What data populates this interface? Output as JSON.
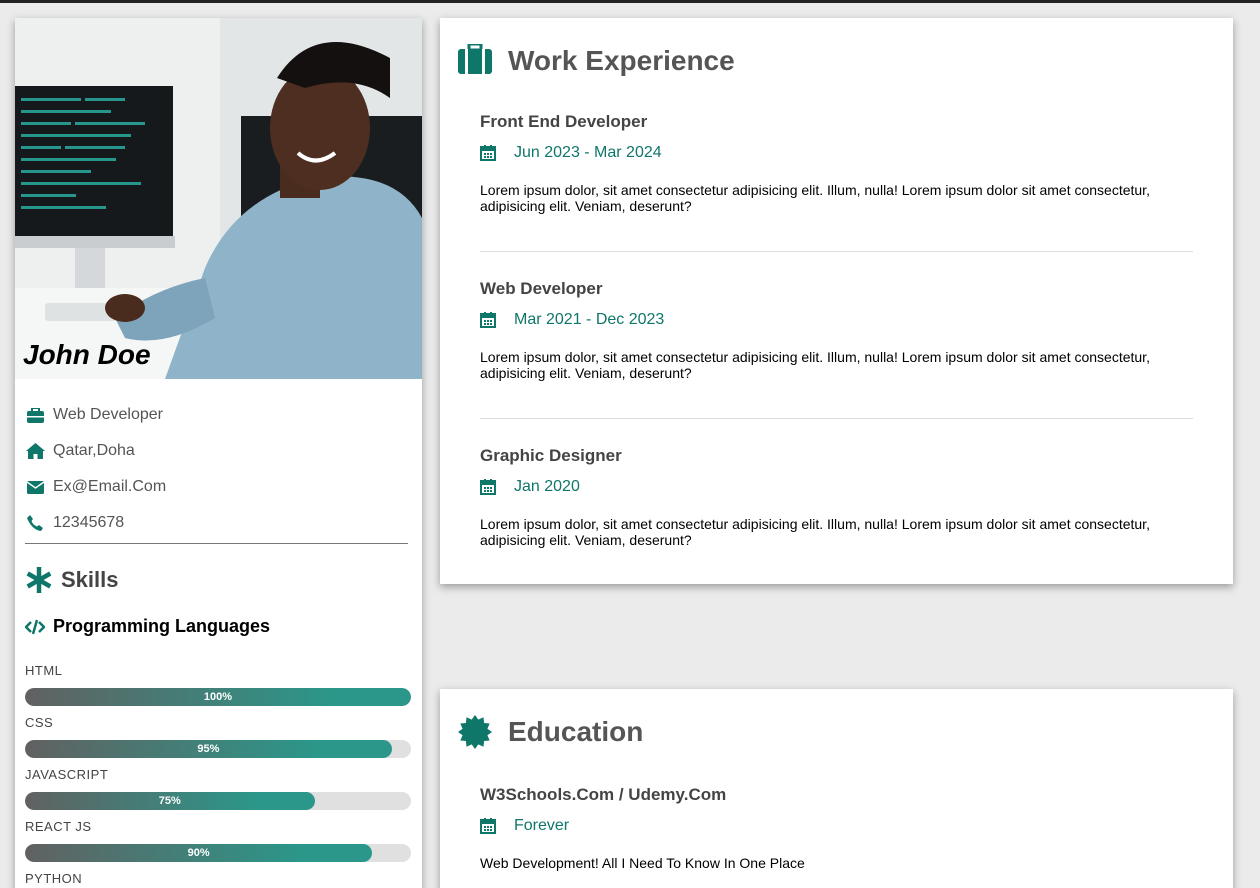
{
  "colors": {
    "accent": "#0f766a",
    "bar_gray": "#616161",
    "bar_teal": "#2b978a"
  },
  "profile": {
    "name": "John Doe",
    "info": [
      {
        "icon": "briefcase-icon",
        "text": "Web Developer"
      },
      {
        "icon": "home-icon",
        "text": "Qatar,Doha"
      },
      {
        "icon": "envelope-icon",
        "text": "Ex@Email.Com"
      },
      {
        "icon": "phone-icon",
        "text": "12345678"
      }
    ]
  },
  "skills": {
    "title": "Skills",
    "group_title": "Programming Languages",
    "items": [
      {
        "name": "HTML",
        "percent": 100,
        "label": "100%"
      },
      {
        "name": "CSS",
        "percent": 95,
        "label": "95%"
      },
      {
        "name": "JAVASCRIPT",
        "percent": 75,
        "label": "75%"
      },
      {
        "name": "REACT JS",
        "percent": 90,
        "label": "90%"
      },
      {
        "name": "PYTHON",
        "percent": 0,
        "label": ""
      }
    ]
  },
  "work": {
    "title": "Work Experience",
    "entries": [
      {
        "title": "Front End Developer",
        "date": "Jun 2023 - Mar 2024",
        "text": "Lorem ipsum dolor, sit amet consectetur adipisicing elit. Illum, nulla! Lorem ipsum dolor sit amet consectetur, adipisicing elit. Veniam, deserunt?"
      },
      {
        "title": "Web Developer",
        "date": "Mar 2021 - Dec 2023",
        "text": "Lorem ipsum dolor, sit amet consectetur adipisicing elit. Illum, nulla! Lorem ipsum dolor sit amet consectetur, adipisicing elit. Veniam, deserunt?"
      },
      {
        "title": "Graphic Designer",
        "date": "Jan 2020",
        "text": "Lorem ipsum dolor, sit amet consectetur adipisicing elit. Illum, nulla! Lorem ipsum dolor sit amet consectetur, adipisicing elit. Veniam, deserunt?"
      }
    ]
  },
  "education": {
    "title": "Education",
    "entries": [
      {
        "title": "W3Schools.Com / Udemy.Com",
        "date": "Forever",
        "text": "Web Development! All I Need To Know In One Place"
      }
    ]
  }
}
